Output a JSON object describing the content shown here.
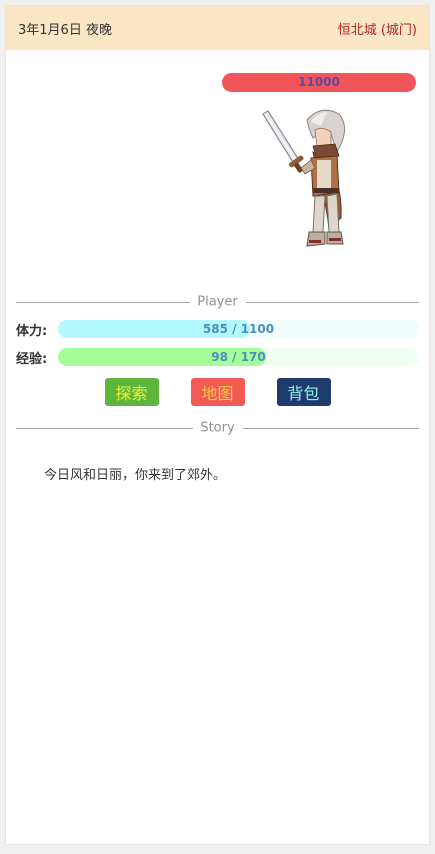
{
  "header": {
    "date": "3年1月6日 夜晚",
    "location": "恒北城 (城门)"
  },
  "enemy": {
    "hp_text": "11000",
    "sprite_icon": "swordsman-character-icon"
  },
  "player_section": {
    "title": "Player"
  },
  "stats": {
    "stamina": {
      "label": "体力:",
      "text": "585 / 1100",
      "current": 585,
      "max": 1100
    },
    "experience": {
      "label": "经验:",
      "text": "98 / 170",
      "current": 98,
      "max": 170
    }
  },
  "actions": {
    "explore": "探索",
    "map": "地图",
    "bag": "背包"
  },
  "story_section": {
    "title": "Story",
    "text": "今日风和日丽，你来到了郊外。"
  },
  "colors": {
    "header_bg": "#fbe6c6",
    "location_text": "#b3261e",
    "hp_bar": "#f1555a",
    "stamina_fill": "#b3f8fc",
    "exp_fill": "#a5ff98",
    "explore_button": "#5eb53c",
    "map_button": "#f25a55",
    "bag_button": "#1f3a6c"
  }
}
